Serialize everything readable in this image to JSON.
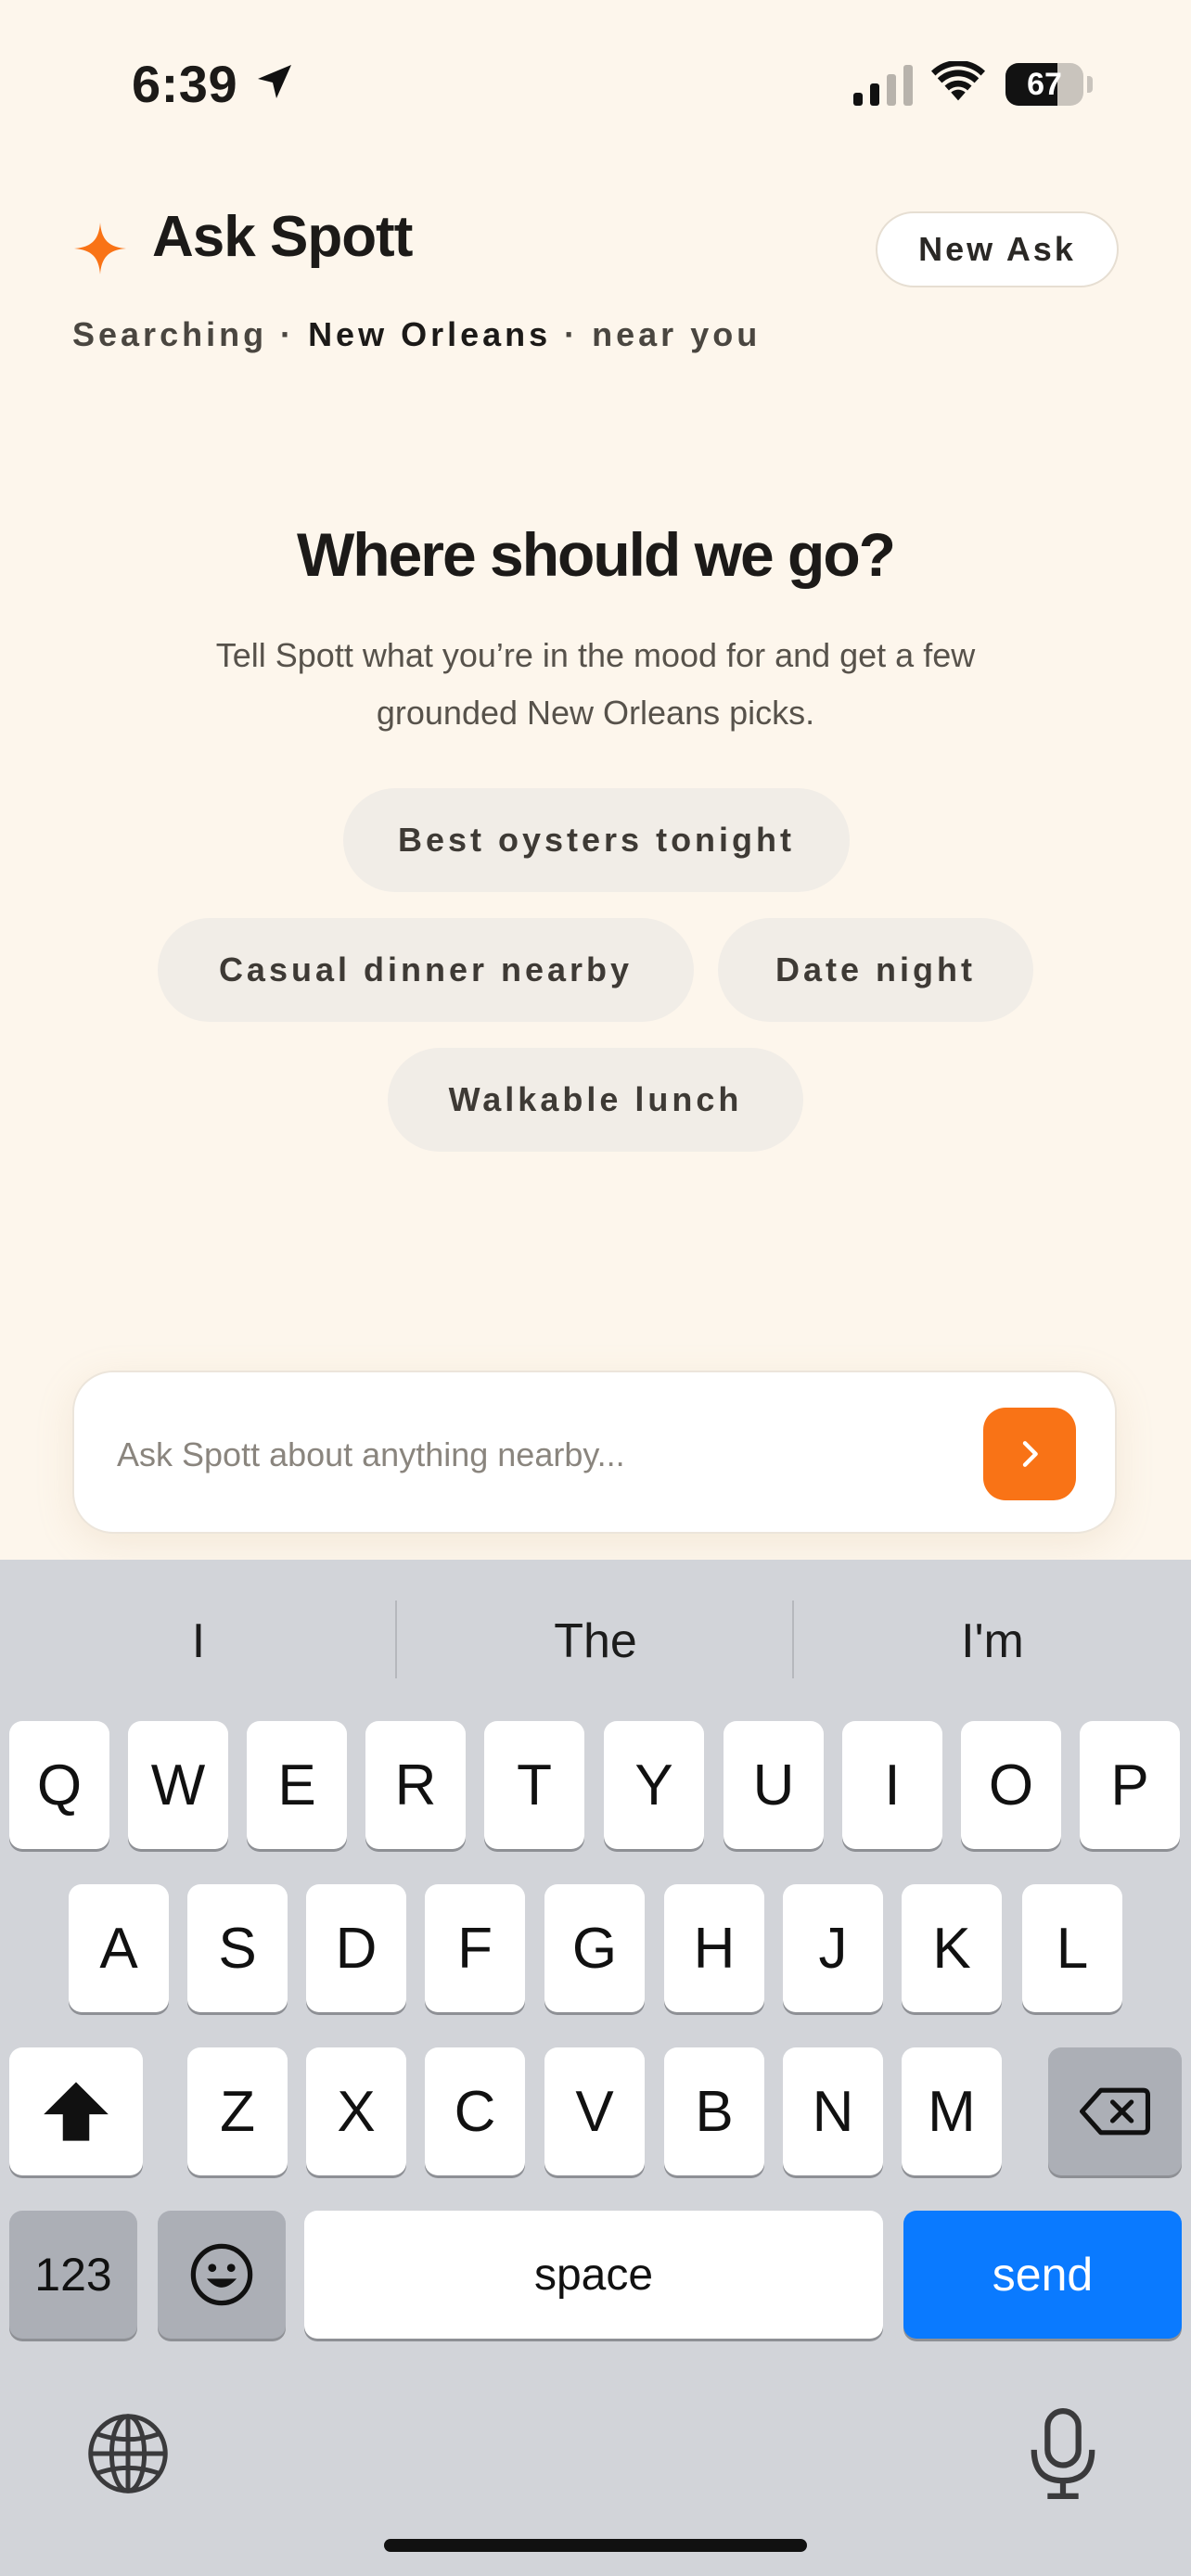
{
  "status_bar": {
    "time": "6:39",
    "battery_level": "67",
    "battery_fraction": 0.67
  },
  "header": {
    "title": "Ask Spott",
    "new_ask_label": "New Ask",
    "location": {
      "prefix": "Searching · ",
      "city": "New Orleans",
      "suffix": " · near you"
    }
  },
  "hero": {
    "title": "Where should we go?",
    "subtitle": "Tell Spott what you’re in the mood for and get a few grounded New Orleans picks."
  },
  "chips": [
    {
      "label": "Best oysters tonight"
    },
    {
      "label": "Casual dinner nearby"
    },
    {
      "label": "Date night"
    },
    {
      "label": "Walkable lunch"
    }
  ],
  "composer": {
    "placeholder": "Ask Spott about anything nearby...",
    "value": ""
  },
  "keyboard": {
    "suggestions": [
      "I",
      "The",
      "I'm"
    ],
    "row1": [
      "Q",
      "W",
      "E",
      "R",
      "T",
      "Y",
      "U",
      "I",
      "O",
      "P"
    ],
    "row2": [
      "A",
      "S",
      "D",
      "F",
      "G",
      "H",
      "J",
      "K",
      "L"
    ],
    "row3": [
      "Z",
      "X",
      "C",
      "V",
      "B",
      "N",
      "M"
    ],
    "numbers_label": "123",
    "space_label": "space",
    "send_label": "send"
  },
  "colors": {
    "accent": "#f97316",
    "background": "#fdf6ec",
    "keyboard_send": "#0a7aff"
  }
}
